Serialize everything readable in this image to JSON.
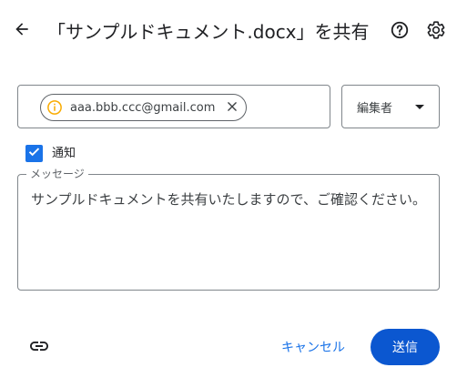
{
  "header": {
    "title": "「サンプルドキュメント.docx」を共有"
  },
  "recipient": {
    "email": "aaa.bbb.ccc@gmail.com"
  },
  "role": {
    "selected": "編集者"
  },
  "notify": {
    "label": "通知",
    "checked": true
  },
  "message": {
    "legend": "メッセージ",
    "text": "サンプルドキュメントを共有いたしますので、ご確認ください。"
  },
  "footer": {
    "cancel_label": "キャンセル",
    "send_label": "送信"
  },
  "colors": {
    "primary": "#0b57d0",
    "accent": "#1a73e8",
    "warning": "#f9ab00"
  }
}
